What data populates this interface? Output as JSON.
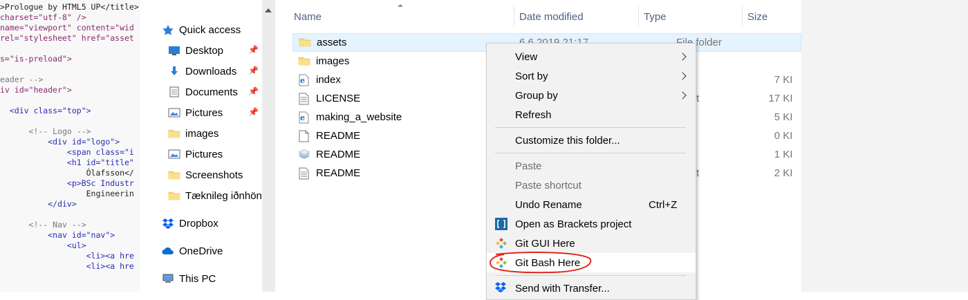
{
  "code_editor": {
    "lines": [
      ">Prologue by HTML5 UP</title>",
      "charset=\"utf-8\" />",
      "name=\"viewport\" content=\"wid",
      "rel=\"stylesheet\" href=\"asset",
      "",
      "s=\"is-preload\">",
      "",
      "eader -->",
      "iv id=\"header\">",
      "",
      "  <div class=\"top\">",
      "",
      "      <!-- Logo -->",
      "          <div id=\"logo\">",
      "              <span class=\"i",
      "              <h1 id=\"title\"",
      "                  Ólafsson</",
      "              <p>BSc Industr",
      "                  Engineerin",
      "          </div>",
      "",
      "      <!-- Nav -->",
      "          <nav id=\"nav\">",
      "              <ul>",
      "                  <li><a hre",
      "                  <li><a hre"
    ]
  },
  "nav": {
    "items": [
      {
        "label": "Quick access",
        "icon": "star-icon"
      },
      {
        "label": "Desktop",
        "icon": "desktop-icon",
        "pinned": true
      },
      {
        "label": "Downloads",
        "icon": "download-icon",
        "pinned": true
      },
      {
        "label": "Documents",
        "icon": "documents-icon",
        "pinned": true
      },
      {
        "label": "Pictures",
        "icon": "pictures-icon",
        "pinned": true
      },
      {
        "label": "images",
        "icon": "folder-icon"
      },
      {
        "label": "Pictures",
        "icon": "pictures-icon"
      },
      {
        "label": "Screenshots",
        "icon": "folder-icon"
      },
      {
        "label": "Tæknileg iðnhönn",
        "icon": "folder-icon"
      },
      {
        "label": "Dropbox",
        "icon": "dropbox-icon"
      },
      {
        "label": "OneDrive",
        "icon": "cloud-icon"
      },
      {
        "label": "This PC",
        "icon": "computer-icon"
      }
    ],
    "pin_glyph": "📌"
  },
  "columns": {
    "name": "Name",
    "date_modified": "Date modified",
    "type": "Type",
    "size": "Size"
  },
  "files": [
    {
      "name": "assets",
      "icon": "folder-icon",
      "date": "6.6.2019 21:17",
      "type": "File folder",
      "size": "",
      "selected": true
    },
    {
      "name": "images",
      "icon": "folder-icon",
      "date": "",
      "type": "",
      "size": ""
    },
    {
      "name": "index",
      "icon": "html-file-icon",
      "date": "",
      "type": "",
      "size": "7 KI"
    },
    {
      "name": "LICENSE",
      "icon": "text-file-icon",
      "date": "",
      "type": "ment",
      "size": "17 KI"
    },
    {
      "name": "making_a_website",
      "icon": "html-file-icon",
      "date": "",
      "type": "",
      "size": "5 KI"
    },
    {
      "name": "README",
      "icon": "blank-file-icon",
      "date": "",
      "type": "",
      "size": "0 KI"
    },
    {
      "name": "README",
      "icon": "stack-file-icon",
      "date": "",
      "type": "",
      "size": "1 KI"
    },
    {
      "name": "README",
      "icon": "text-file-icon",
      "date": "",
      "type": "ment",
      "size": "2 KI"
    }
  ],
  "context_menu": {
    "items": [
      {
        "label": "View",
        "submenu": true
      },
      {
        "label": "Sort by",
        "submenu": true
      },
      {
        "label": "Group by",
        "submenu": true
      },
      {
        "label": "Refresh"
      },
      {
        "separator": true
      },
      {
        "label": "Customize this folder..."
      },
      {
        "separator": true
      },
      {
        "label": "Paste",
        "disabled": true
      },
      {
        "label": "Paste shortcut",
        "disabled": true
      },
      {
        "label": "Undo Rename",
        "shortcut": "Ctrl+Z"
      },
      {
        "label": "Open as Brackets project",
        "icon": "brackets-icon"
      },
      {
        "label": "Git GUI Here",
        "icon": "git-icon"
      },
      {
        "label": "Git Bash Here",
        "icon": "git-icon",
        "highlighted": true
      },
      {
        "separator": true
      },
      {
        "label": "Send with Transfer...",
        "icon": "dropbox-icon"
      }
    ]
  },
  "colors": {
    "selection_bg": "#e5f3ff",
    "header_text": "#4d6182",
    "menu_bg": "#f2f2f2",
    "annotation": "#e0281c",
    "folder": "#f8d775",
    "dropbox": "#0061fe"
  }
}
